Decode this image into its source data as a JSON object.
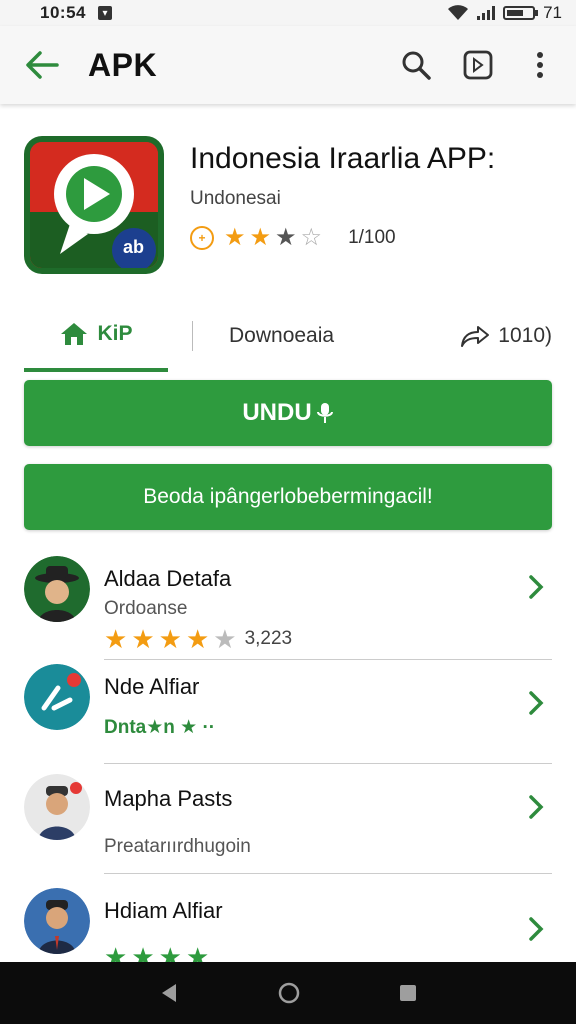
{
  "status_bar": {
    "time": "10:54",
    "battery_level": "71"
  },
  "app_bar": {
    "title": "APK"
  },
  "app": {
    "name": "Indonesia Iraarlia APP:",
    "developer": "Undonesai",
    "rating_count": "1/100",
    "coin_label": "+",
    "icon_badge_text": "ab"
  },
  "tabs": {
    "kip_label": "KiP",
    "download_label": "Downoeaia",
    "share_label": "1010)"
  },
  "buttons": {
    "primary_label": "UNDU",
    "secondary_label": "Beoda ipângerlobebermingacil!"
  },
  "list": [
    {
      "name": "Aldaa Detafa",
      "sub": "Ordoanse",
      "rating_count": "3,223",
      "stars": 4.5
    },
    {
      "name": "Nde Alfiar",
      "sub": "Dnta★n ★ ··"
    },
    {
      "name": "Mapha Pasts",
      "sub": "Preatarıırdhugoin"
    },
    {
      "name": "Hdiam Alfiar"
    }
  ],
  "colors": {
    "accent": "#2e9b3e",
    "star": "#f39c12",
    "nav": "#0c0c0c"
  }
}
